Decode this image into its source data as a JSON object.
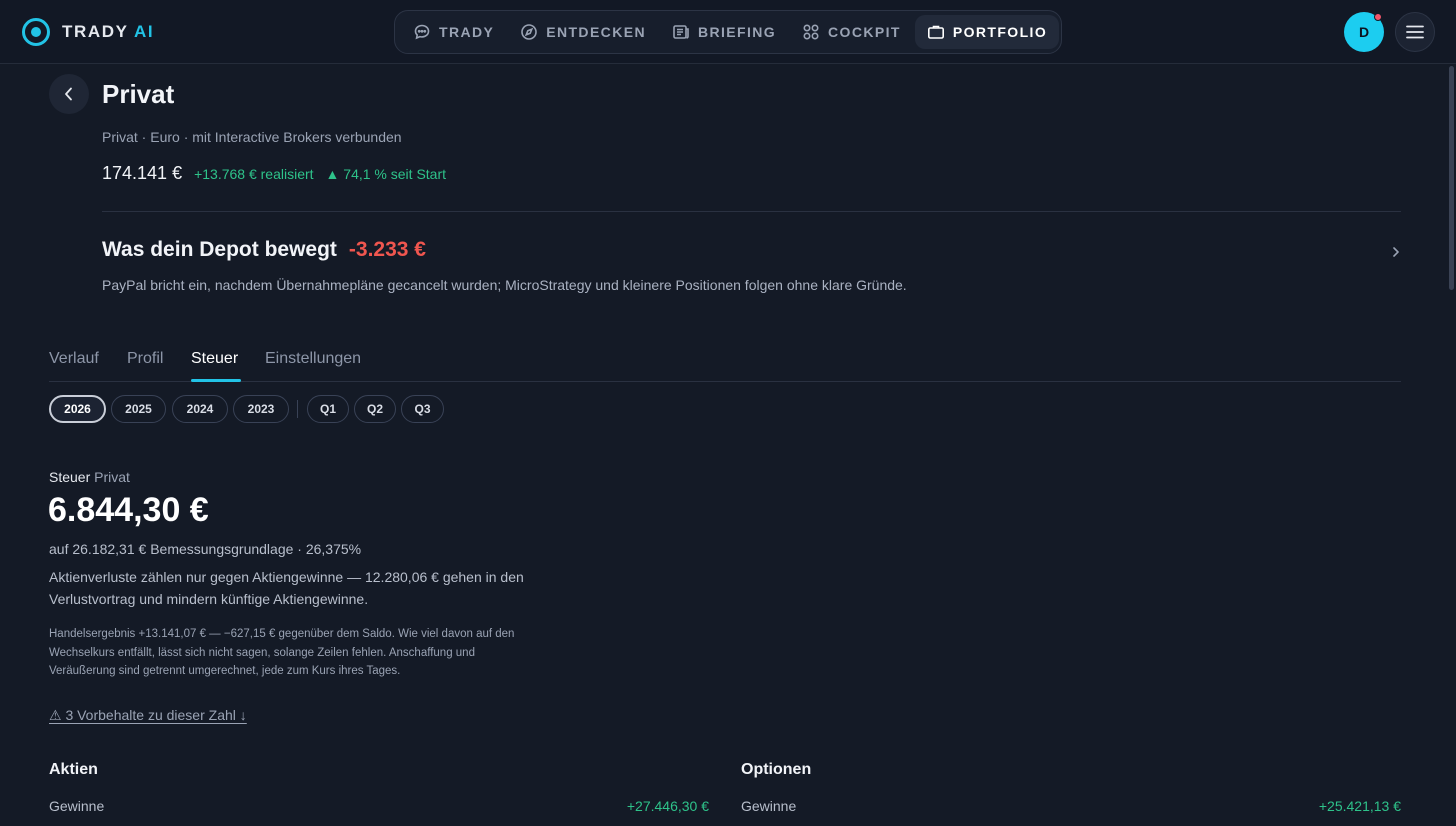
{
  "brand": {
    "name": "TRADY",
    "suffix": "AI"
  },
  "nav": {
    "items": [
      {
        "label": "TRADY",
        "icon": "chat-bubble-icon"
      },
      {
        "label": "ENTDECKEN",
        "icon": "compass-icon"
      },
      {
        "label": "BRIEFING",
        "icon": "newspaper-icon"
      },
      {
        "label": "COCKPIT",
        "icon": "grid-icon"
      },
      {
        "label": "PORTFOLIO",
        "icon": "briefcase-icon",
        "active": true
      }
    ]
  },
  "user": {
    "initial": "D",
    "notification": true
  },
  "portfolio": {
    "title": "Privat",
    "subtitle": "Privat · Euro · mit Interactive Brokers verbunden",
    "value": "174.141 €",
    "realized": "+13.768 € realisiert",
    "since_start": "▲ 74,1 % seit Start"
  },
  "insight": {
    "title": "Was dein Depot bewegt",
    "value": "-3.233 €",
    "text": "PayPal bricht ein, nachdem Übernahmepläne gecancelt wurden; MicroStrategy und kleinere Positionen folgen ohne klare Gründe."
  },
  "tabs": [
    {
      "label": "Verlauf"
    },
    {
      "label": "Profil"
    },
    {
      "label": "Steuer",
      "active": true
    },
    {
      "label": "Einstellungen"
    }
  ],
  "years": [
    "2026",
    "2025",
    "2024",
    "2023"
  ],
  "selected_year": "2026",
  "quarters": [
    "Q1",
    "Q2",
    "Q3"
  ],
  "tax": {
    "label_prefix": "Steuer",
    "label_name": "Privat",
    "amount": "6.844,30 €",
    "basis": "auf 26.182,31 € Bemessungsgrundlage · 26,375%",
    "note": "Aktienverluste zählen nur gegen Aktiengewinne — 12.280,06 € gehen in den Verlustvortrag und mindern künftige Aktiengewinne.",
    "small_note": "Handelsergebnis +13.141,07 € — −627,15 € gegenüber dem Saldo. Wie viel davon auf den Wechselkurs entfällt, lässt sich nicht sagen, solange Zeilen fehlen. Anschaffung und Veräußerung sind getrennt umgerechnet, jede zum Kurs ihres Tages.",
    "caveats_link": "⚠ 3 Vorbehalte zu dieser Zahl ↓"
  },
  "sections": {
    "aktien": {
      "title": "Aktien",
      "row_label": "Gewinne",
      "row_value": "+27.446,30 €"
    },
    "optionen": {
      "title": "Optionen",
      "row_label": "Gewinne",
      "row_value": "+25.421,13 €"
    }
  },
  "colors": {
    "accent": "#22c3e6",
    "positive": "#2ec28a",
    "negative": "#f0564f",
    "background": "#141a26"
  }
}
